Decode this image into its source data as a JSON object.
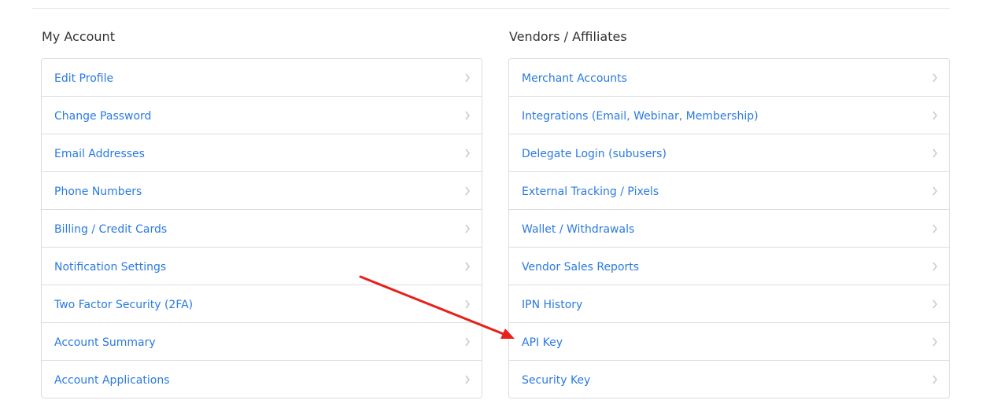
{
  "left_section": {
    "title": "My Account",
    "items": [
      {
        "label": "Edit Profile"
      },
      {
        "label": "Change Password"
      },
      {
        "label": "Email Addresses"
      },
      {
        "label": "Phone Numbers"
      },
      {
        "label": "Billing / Credit Cards"
      },
      {
        "label": "Notification Settings"
      },
      {
        "label": "Two Factor Security (2FA)"
      },
      {
        "label": "Account Summary"
      },
      {
        "label": "Account Applications"
      }
    ]
  },
  "right_section": {
    "title": "Vendors / Affiliates",
    "items": [
      {
        "label": "Merchant Accounts"
      },
      {
        "label": "Integrations (Email, Webinar, Membership)"
      },
      {
        "label": "Delegate Login (subusers)"
      },
      {
        "label": "External Tracking / Pixels"
      },
      {
        "label": "Wallet / Withdrawals"
      },
      {
        "label": "Vendor Sales Reports"
      },
      {
        "label": "IPN History"
      },
      {
        "label": "API Key"
      },
      {
        "label": "Security Key"
      }
    ]
  },
  "icons": {
    "chevron": "chevron-right-icon",
    "annotation": "red-arrow-annotation"
  },
  "colors": {
    "link": "#2a7ae2",
    "heading": "#333333",
    "border": "#dddddd",
    "chevron": "#c8c8c8",
    "annotation_arrow": "#e8201c"
  }
}
